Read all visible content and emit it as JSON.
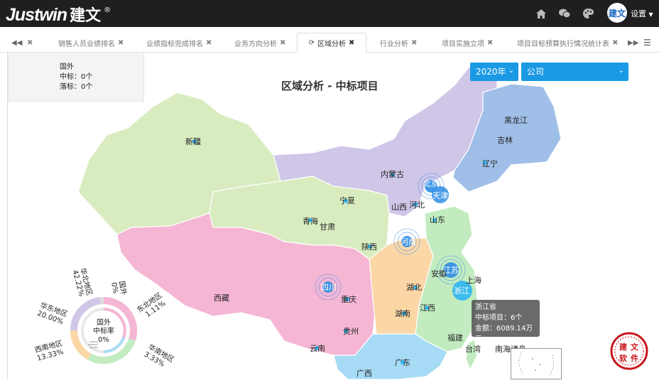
{
  "app": {
    "logo_en": "Justwin",
    "logo_cn": "建文",
    "logo_reg": "®",
    "avatar_text": "建文",
    "settings_label": "设置"
  },
  "header": {
    "icons": [
      "home-icon",
      "chat-icon",
      "palette-icon"
    ]
  },
  "tabs": [
    {
      "label": "销售人员业绩排名",
      "active": false
    },
    {
      "label": "业绩指标完成排名",
      "active": false
    },
    {
      "label": "业务方向分析",
      "active": false
    },
    {
      "label": "区域分析",
      "active": true
    },
    {
      "label": "行业分析",
      "active": false
    },
    {
      "label": "项目实施立项",
      "active": false
    },
    {
      "label": "项目目标预算执行情况统计表",
      "active": false
    }
  ],
  "infobox": {
    "region": "国外",
    "won": "中标：0个",
    "lost": "落标：0个"
  },
  "chart": {
    "title": "区域分析 - 中标项目",
    "year_select": "2020年",
    "company_select": "公司"
  },
  "tooltip": {
    "province": "浙江省",
    "count_line": "中标项目：6个",
    "amount_line": "金额：6089.14万元"
  },
  "map_labels": [
    "新疆",
    "西藏",
    "青海",
    "甘肃",
    "宁夏",
    "内蒙古",
    "黑龙江",
    "吉林",
    "辽宁",
    "北京",
    "天津",
    "河北",
    "山西",
    "山东",
    "陕西",
    "河南",
    "四川",
    "重庆",
    "湖北",
    "安徽",
    "江苏",
    "上海",
    "浙江",
    "江西",
    "湖南",
    "贵州",
    "云南",
    "福建",
    "台湾",
    "广东",
    "广西",
    "南海诸岛"
  ],
  "donut": {
    "center_line1": "国外",
    "center_line2": "中标率",
    "center_line3": "0%",
    "labels": [
      {
        "name": "华北地区",
        "pct": "42.22%"
      },
      {
        "name": "国外",
        "pct": "0%"
      },
      {
        "name": "东北地区",
        "pct": "1.11%"
      },
      {
        "name": "华南地区",
        "pct": "3.33%"
      },
      {
        "name": "华东地区",
        "pct": "20.00%"
      },
      {
        "name": "西南地区",
        "pct": "13.33%"
      }
    ]
  },
  "seal_text": "建文软件",
  "colors": {
    "top_bar": "#1f1f1f",
    "select_blue": "#1a99e4",
    "xinjiang_green": "#d9ecc0",
    "north_purple": "#cfc6e8",
    "northeast_blue": "#9fbfe8",
    "southwest_pink": "#f5b6d4",
    "central_orange": "#fbd7a6",
    "east_green": "#c2ecc0",
    "south_blue": "#a7dbf5"
  }
}
